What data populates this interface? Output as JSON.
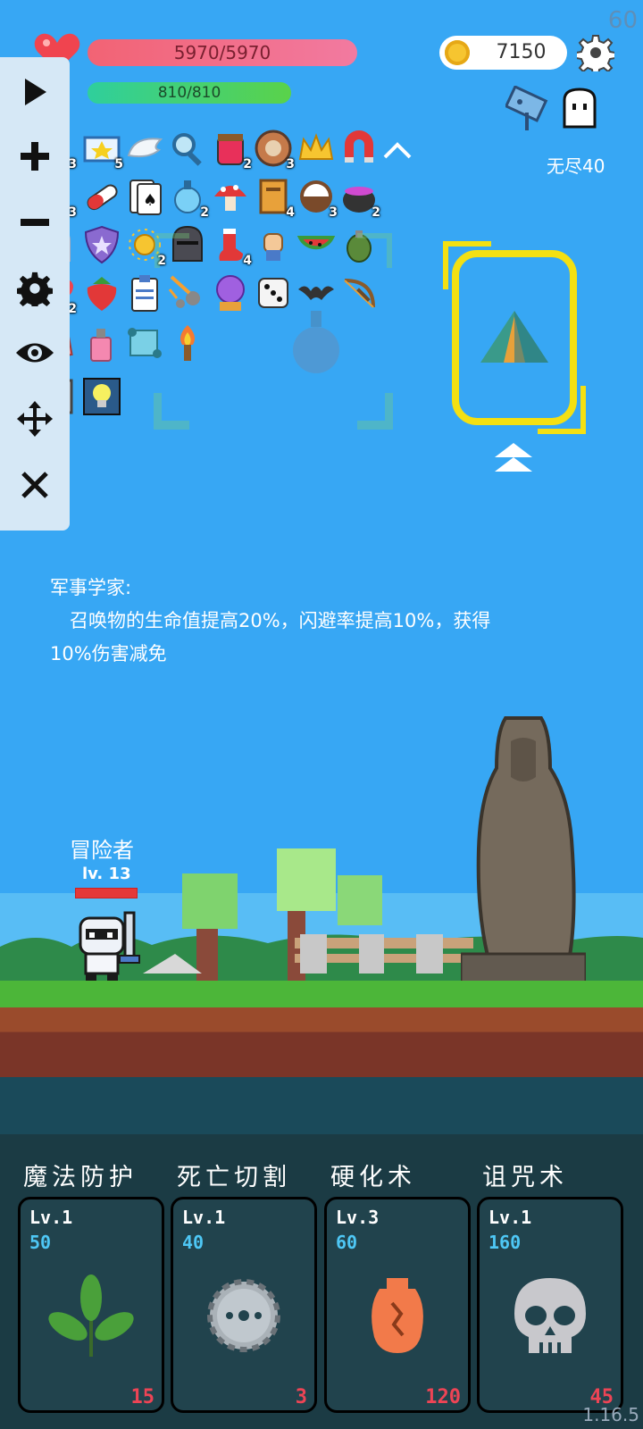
{
  "fps": "60",
  "hud": {
    "hp": "5970/5970",
    "mp": "810/810",
    "coins": "7150",
    "mode": "无尽40"
  },
  "inventory": [
    {
      "icon": "sword-icon",
      "count": "3"
    },
    {
      "icon": "gem-card-icon",
      "count": "5"
    },
    {
      "icon": "wing-icon",
      "count": ""
    },
    {
      "icon": "magnifier-icon",
      "count": ""
    },
    {
      "icon": "jam-jar-icon",
      "count": "2"
    },
    {
      "icon": "shield-ring-icon",
      "count": "3"
    },
    {
      "icon": "crown-icon",
      "count": ""
    },
    {
      "icon": "magnet-icon",
      "count": ""
    },
    {
      "icon": "flower-icon",
      "count": "3"
    },
    {
      "icon": "pill-icon",
      "count": ""
    },
    {
      "icon": "playing-card-icon",
      "count": ""
    },
    {
      "icon": "potion-flask-icon",
      "count": "2"
    },
    {
      "icon": "mushroom-icon",
      "count": ""
    },
    {
      "icon": "book-icon",
      "count": "4"
    },
    {
      "icon": "coconut-icon",
      "count": "3"
    },
    {
      "icon": "cauldron-icon",
      "count": "2"
    },
    {
      "icon": "ghost-icon",
      "count": ""
    },
    {
      "icon": "star-shield-icon",
      "count": ""
    },
    {
      "icon": "sun-orb-icon",
      "count": "2"
    },
    {
      "icon": "knight-helmet-icon",
      "count": ""
    },
    {
      "icon": "sock-icon",
      "count": "4"
    },
    {
      "icon": "fist-icon",
      "count": ""
    },
    {
      "icon": "watermelon-icon",
      "count": ""
    },
    {
      "icon": "grenade-icon",
      "count": ""
    },
    {
      "icon": "heart-icon",
      "count": "2"
    },
    {
      "icon": "strawberry-icon",
      "count": ""
    },
    {
      "icon": "clipboard-icon",
      "count": ""
    },
    {
      "icon": "meteor-icon",
      "count": ""
    },
    {
      "icon": "crystal-ball-icon",
      "count": ""
    },
    {
      "icon": "dice-icon",
      "count": ""
    },
    {
      "icon": "bat-icon",
      "count": ""
    },
    {
      "icon": "crossbow-icon",
      "count": ""
    },
    {
      "icon": "armor-scroll-icon",
      "count": ""
    },
    {
      "icon": "spray-bottle-icon",
      "count": ""
    },
    {
      "icon": "scroll-icon",
      "count": ""
    },
    {
      "icon": "torch-icon",
      "count": ""
    },
    {
      "icon": "mirror-icon",
      "count": ""
    },
    {
      "icon": "lightbulb-icon",
      "count": ""
    }
  ],
  "description": {
    "title": "军事学家:",
    "line1": "召唤物的生命值提高20%，闪避率提高10%，获得",
    "line2": "10%伤害减免"
  },
  "player": {
    "name": "冒险者",
    "level": "lv. 13",
    "hp_fraction": 1.0
  },
  "skills": [
    {
      "name": "魔法防护",
      "level": "Lv.1",
      "cost": "50",
      "count": "15",
      "icon": "leaf-icon"
    },
    {
      "name": "死亡切割",
      "level": "Lv.1",
      "cost": "40",
      "count": "3",
      "icon": "saw-blade-icon"
    },
    {
      "name": "硬化术",
      "level": "Lv.3",
      "cost": "60",
      "count": "120",
      "icon": "cracked-vase-icon"
    },
    {
      "name": "诅咒术",
      "level": "Lv.1",
      "cost": "160",
      "count": "45",
      "icon": "skull-icon"
    }
  ],
  "version": "1.16.5",
  "colors": {
    "sky": "#37a7f4",
    "hp": "#f26374",
    "mp": "#5ad24a",
    "cost_blue": "#4ec7f5",
    "count_red": "#ee4455",
    "highlight_yellow": "#f4e012"
  }
}
